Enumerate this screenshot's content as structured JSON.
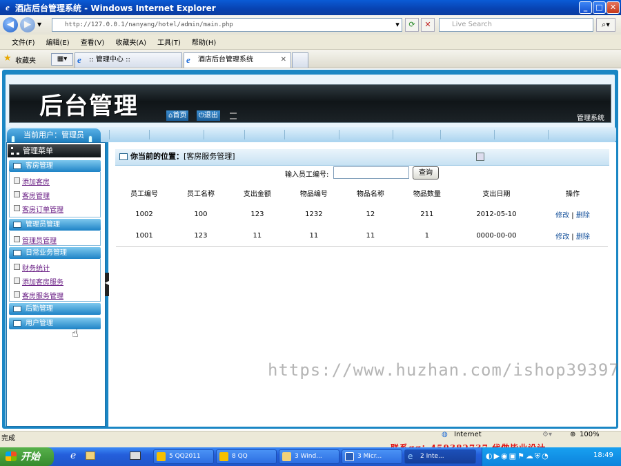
{
  "window": {
    "title": "酒店后台管理系统 - Windows Internet Explorer",
    "min": "_",
    "max": "□",
    "close": "✕"
  },
  "address": {
    "url": "http://127.0.0.1/nanyang/hotel/admin/main.php",
    "search_placeholder": "Live Search"
  },
  "menu": [
    "文件(F)",
    "编辑(E)",
    "查看(V)",
    "收藏夹(A)",
    "工具(T)",
    "帮助(H)"
  ],
  "favorites": {
    "label": "收藏夹"
  },
  "tabs": [
    {
      "label": ":: 管理中心 ::"
    },
    {
      "label": "酒店后台管理系统",
      "close": "✕"
    }
  ],
  "banner": {
    "title": "后台管理",
    "home": "首页",
    "logout": "退出",
    "system": "管理系统"
  },
  "user": {
    "label": "当前用户：管理员"
  },
  "sidebar": {
    "header": "管理菜单",
    "groups": [
      {
        "title": "客房管理",
        "items": [
          "添加客房",
          "客房管理",
          "客房订单管理"
        ]
      },
      {
        "title": "管理员管理",
        "items": [
          "管理员管理"
        ]
      },
      {
        "title": "日常业务管理",
        "items": [
          "财务统计",
          "添加客房服务",
          "客房服务管理"
        ]
      },
      {
        "title": "后勤管理",
        "items": []
      },
      {
        "title": "用户管理",
        "items": []
      }
    ]
  },
  "main": {
    "location_prefix": "你当前的位置：",
    "location": "[客房服务管理]",
    "search_label": "输入员工编号:",
    "search_value": "",
    "query_button": "查询",
    "columns": [
      "员工编号",
      "员工名称",
      "支出金额",
      "物品编号",
      "物品名称",
      "物品数量",
      "支出日期",
      "操作"
    ],
    "rows": [
      [
        "1002",
        "100",
        "123",
        "1232",
        "12",
        "211",
        "2012-05-10"
      ],
      [
        "1001",
        "123",
        "11",
        "11",
        "11",
        "1",
        "0000-00-00"
      ]
    ],
    "edit": "修改",
    "sep": "|",
    "delete": "删除"
  },
  "watermark": "https://www.huzhan.com/ishop39397",
  "status": {
    "text": "完成",
    "zone": "Internet",
    "zoom": "100%"
  },
  "contact": "联系qq：459382737 代做毕业设计",
  "taskbar": {
    "start": "开始",
    "items": [
      "5 QQ2011",
      "8 QQ",
      "3 Wind...",
      "3 Micr...",
      "2 Inte..."
    ],
    "clock": "18:49"
  },
  "colors": {
    "frame": "#1a86c4",
    "banner": "#101518",
    "link": "#6a1f85",
    "ops": "#14509a",
    "contact": "#e01010"
  }
}
